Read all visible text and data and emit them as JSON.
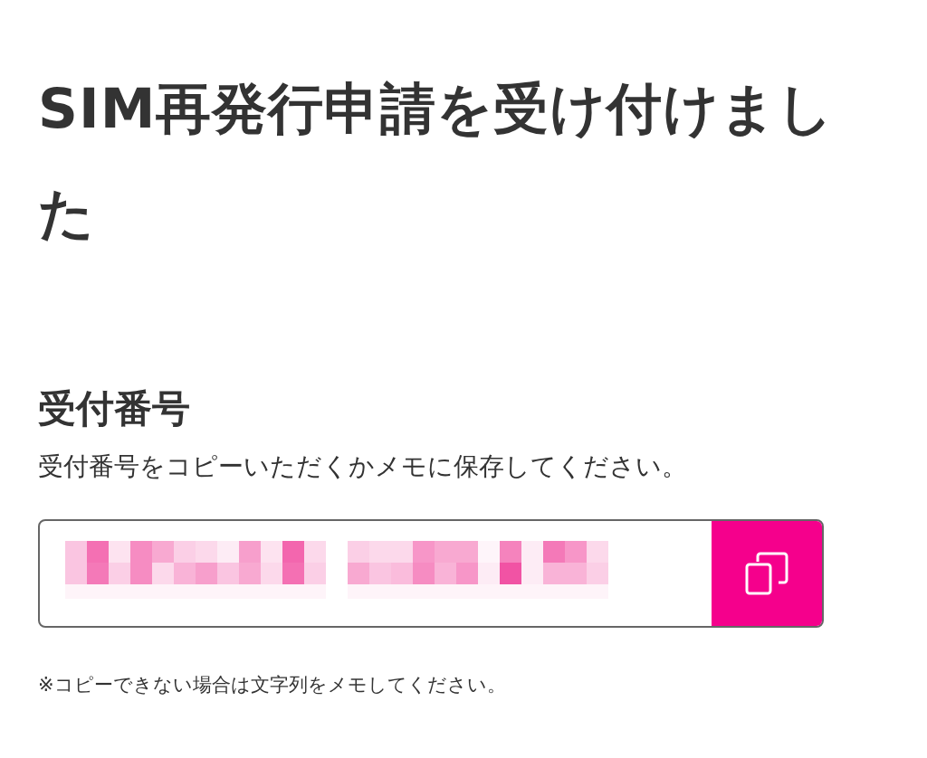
{
  "title": "SIM再発行申請を受け付けました",
  "section": {
    "heading": "受付番号",
    "description": "受付番号をコピーいただくかメモに保存してください。"
  },
  "number_field": {
    "copy_button": {
      "kind": "copy"
    }
  },
  "note": "※コピーできない場合は文字列をメモしてください。"
}
